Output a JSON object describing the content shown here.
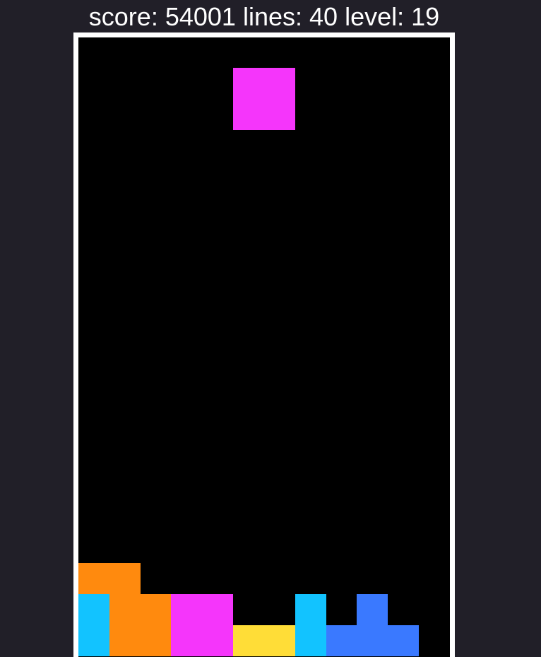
{
  "hud": {
    "score_label": "score:",
    "score": "54001",
    "lines_label": "lines:",
    "lines": "40",
    "level_label": "level:",
    "level": "19"
  },
  "colors": {
    "background": "#211f28",
    "frame": "#ffffff",
    "board": "#000000",
    "orange": "#ff8a0e",
    "cyan": "#12c3ff",
    "magenta": "#f535fb",
    "yellow": "#ffdd37",
    "blue": "#3a79ff"
  },
  "board": {
    "columns": 12,
    "rows": 20
  },
  "active_piece": {
    "color": "magenta",
    "cells": [
      [
        5,
        1
      ],
      [
        6,
        1
      ],
      [
        5,
        2
      ],
      [
        6,
        2
      ]
    ]
  },
  "locked_cells": [
    {
      "col": 0,
      "row": 17,
      "color": "orange"
    },
    {
      "col": 1,
      "row": 17,
      "color": "orange"
    },
    {
      "col": 1,
      "row": 18,
      "color": "orange"
    },
    {
      "col": 2,
      "row": 18,
      "color": "orange"
    },
    {
      "col": 1,
      "row": 19,
      "color": "orange"
    },
    {
      "col": 2,
      "row": 19,
      "color": "orange"
    },
    {
      "col": 0,
      "row": 18,
      "color": "cyan"
    },
    {
      "col": 0,
      "row": 19,
      "color": "cyan"
    },
    {
      "col": 3,
      "row": 18,
      "color": "magenta"
    },
    {
      "col": 4,
      "row": 18,
      "color": "magenta"
    },
    {
      "col": 3,
      "row": 19,
      "color": "magenta"
    },
    {
      "col": 4,
      "row": 19,
      "color": "magenta"
    },
    {
      "col": 5,
      "row": 19,
      "color": "yellow"
    },
    {
      "col": 6,
      "row": 19,
      "color": "yellow"
    },
    {
      "col": 7,
      "row": 18,
      "color": "cyan"
    },
    {
      "col": 7,
      "row": 19,
      "color": "cyan"
    },
    {
      "col": 8,
      "row": 19,
      "color": "blue"
    },
    {
      "col": 9,
      "row": 18,
      "color": "blue"
    },
    {
      "col": 9,
      "row": 19,
      "color": "blue"
    },
    {
      "col": 10,
      "row": 19,
      "color": "blue"
    }
  ]
}
